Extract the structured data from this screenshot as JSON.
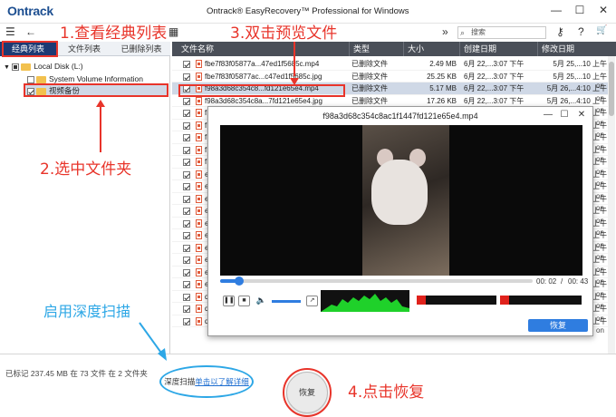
{
  "app": {
    "logo": "Ontrack",
    "title": "Ontrack® EasyRecovery™ Professional for Windows"
  },
  "window_controls": {
    "minimize": "—",
    "maximize": "☐",
    "close": "✕"
  },
  "toolbar": {
    "menu": "☰",
    "back": "←",
    "grid": "▦",
    "forward": "»",
    "search_placeholder": "搜索",
    "key": "⚷",
    "help": "?",
    "cart": "🛒"
  },
  "tabs": [
    "经典列表",
    "文件列表",
    "已删除列表"
  ],
  "tree": {
    "disk": "Local Disk (L:)",
    "svi": "System Volume Information",
    "folder": "视频备份"
  },
  "columns": [
    "文件名称",
    "类型",
    "大小",
    "创建日期",
    "修改日期"
  ],
  "rows": [
    {
      "name": "fbe7f83f05877a...47ed1f5685c.mp4",
      "type": "已删除文件",
      "size": "2.49 MB",
      "created": "6月 22,...3:07 下午",
      "modified": "5月 25,...10 上午"
    },
    {
      "name": "fbe7f83f05877ac...c47ed1f5685c.jpg",
      "type": "已删除文件",
      "size": "25.25 KB",
      "created": "6月 22,...3:07 下午",
      "modified": "5月 25,...10 上午"
    },
    {
      "name": "f98a3d68c354c8...fd121e65e4.mp4",
      "type": "已删除文件",
      "size": "5.17 MB",
      "created": "6月 22,...3:07 下午",
      "modified": "5月 26,...4:10 上午"
    },
    {
      "name": "f98a3d68c354c8a...7fd121e65e4.jpg",
      "type": "已删除文件",
      "size": "17.26 KB",
      "created": "6月 22,...3:07 下午",
      "modified": "5月 26,...4:10 上午"
    },
    {
      "name": "f",
      "type": "",
      "size": "",
      "created": "",
      "modified": "上午"
    },
    {
      "name": "f",
      "type": "",
      "size": "",
      "created": "",
      "modified": "上午"
    },
    {
      "name": "f",
      "type": "",
      "size": "",
      "created": "",
      "modified": "上午"
    },
    {
      "name": "f",
      "type": "",
      "size": "",
      "created": "",
      "modified": "上午"
    },
    {
      "name": "f",
      "type": "",
      "size": "",
      "created": "",
      "modified": "上午"
    },
    {
      "name": "e",
      "type": "",
      "size": "",
      "created": "",
      "modified": "上午"
    },
    {
      "name": "e",
      "type": "",
      "size": "",
      "created": "",
      "modified": "上午"
    },
    {
      "name": "e",
      "type": "",
      "size": "",
      "created": "",
      "modified": "上午"
    },
    {
      "name": "e",
      "type": "",
      "size": "",
      "created": "",
      "modified": "上午"
    },
    {
      "name": "e",
      "type": "",
      "size": "",
      "created": "",
      "modified": "上午"
    },
    {
      "name": "e",
      "type": "",
      "size": "",
      "created": "",
      "modified": "上午"
    },
    {
      "name": "e",
      "type": "",
      "size": "",
      "created": "",
      "modified": "上午"
    },
    {
      "name": "e",
      "type": "",
      "size": "",
      "created": "",
      "modified": "上午"
    },
    {
      "name": "e",
      "type": "",
      "size": "",
      "created": "",
      "modified": "上午"
    },
    {
      "name": "e",
      "type": "",
      "size": "",
      "created": "",
      "modified": "上午"
    },
    {
      "name": "d",
      "type": "",
      "size": "",
      "created": "",
      "modified": "上午"
    },
    {
      "name": "d",
      "type": "",
      "size": "",
      "created": "",
      "modified": "上午"
    },
    {
      "name": "d849d402b5e8bc...74169d526c.mp4",
      "type": "已删除文件",
      "size": "25.20 KB",
      "created": "6月 22,...3:07 下午",
      "modified": "5月 23,...10 上午"
    }
  ],
  "side_labels": [
    "on",
    "on",
    "on",
    "on",
    "on",
    "on",
    "on",
    "on",
    "on",
    "on",
    "on",
    "on",
    "on",
    "on",
    "on",
    "on",
    "on",
    "on",
    "on",
    "on",
    "on"
  ],
  "preview": {
    "title": "f98a3d68c354c8ac1f1447fd121e65e4.mp4",
    "time_current": "00: 02",
    "time_sep": "/",
    "time_total": "00: 43",
    "recover": "恢复",
    "progress_fraction": 0.06
  },
  "bottom": {
    "status": "已标记 237.45 MB 在 73 文件 在 2 文件夹",
    "deep_label": "深度扫描",
    "deep_link": "单击以了解详细",
    "recover": "恢复"
  },
  "annotations": {
    "a1": "1.查看经典列表",
    "a2": "2.选中文件夹",
    "a3": "3.双击预览文件",
    "a4": "4.点击恢复",
    "a5": "启用深度扫描"
  },
  "colors": {
    "accent": "#2f7de0",
    "annotation": "#e8342a",
    "annotation_blue": "#2da7e6",
    "tab_active": "#1d3a73"
  }
}
